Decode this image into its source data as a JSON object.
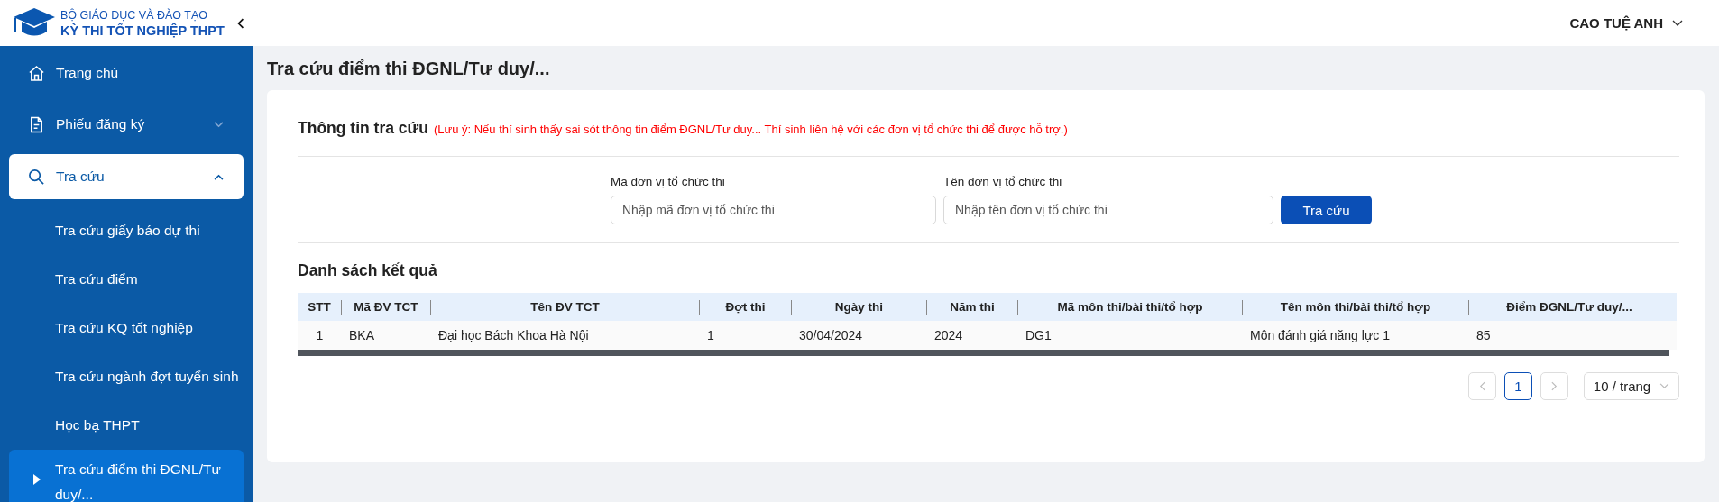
{
  "brand": {
    "line_1": "BỘ GIÁO DỤC VÀ ĐÀO TẠO",
    "line_2": "KỲ THI TỐT NGHIỆP THPT"
  },
  "user": {
    "name": "CAO TUỆ ANH"
  },
  "sidebar": {
    "items": [
      {
        "label": "Trang chủ",
        "selected": false
      },
      {
        "label": "Phiếu đăng ký",
        "selected": false,
        "expanded": false
      },
      {
        "label": "Tra cứu",
        "selected": true,
        "expanded": true,
        "children": [
          {
            "label": "Tra cứu giấy báo dự thi",
            "selected": false
          },
          {
            "label": "Tra cứu điểm",
            "selected": false
          },
          {
            "label": "Tra cứu KQ tốt nghiệp",
            "selected": false
          },
          {
            "label": "Tra cứu ngành đợt tuyển sinh",
            "selected": false
          },
          {
            "label": "Học bạ THPT",
            "selected": false
          },
          {
            "label": "Tra cứu điểm thi ĐGNL/Tư duy/...",
            "selected": true
          }
        ]
      }
    ]
  },
  "page_title": "Tra cứu điểm thi ĐGNL/Tư duy/...",
  "search": {
    "title": "Thông tin tra cứu",
    "note": "(Lưu ý: Nếu thí sinh thấy sai sót thông tin điểm ĐGNL/Tư duy... Thí sinh liên hệ với các đơn vị tổ chức thi để được hỗ trợ.)",
    "fields": [
      {
        "label": "Mã đơn vị tổ chức thi",
        "placeholder": "Nhập mã đơn vị tổ chức thi"
      },
      {
        "label": "Tên đơn vị tổ chức thi",
        "placeholder": "Nhập tên đơn vị tổ chức thi"
      }
    ],
    "button": "Tra cứu"
  },
  "results": {
    "title": "Danh sách kết quả",
    "table": {
      "columns": [
        "STT",
        "Mã ĐV TCT",
        "Tên ĐV TCT",
        "Đợt thi",
        "Ngày thi",
        "Năm thi",
        "Mã môn thi/bài thi/tổ hợp",
        "Tên môn thi/bài thi/tổ hợp",
        "Điểm ĐGNL/Tư duy/..."
      ],
      "rows": [
        [
          "1",
          "BKA",
          "Đại học Bách Khoa Hà Nội",
          "1",
          "30/04/2024",
          "2024",
          "DG1",
          "Môn đánh giá năng lực 1",
          "85"
        ]
      ]
    },
    "pagination": {
      "pages": [
        {
          "label": "1",
          "selected": true
        }
      ],
      "page_size": "10 / trang"
    }
  }
}
